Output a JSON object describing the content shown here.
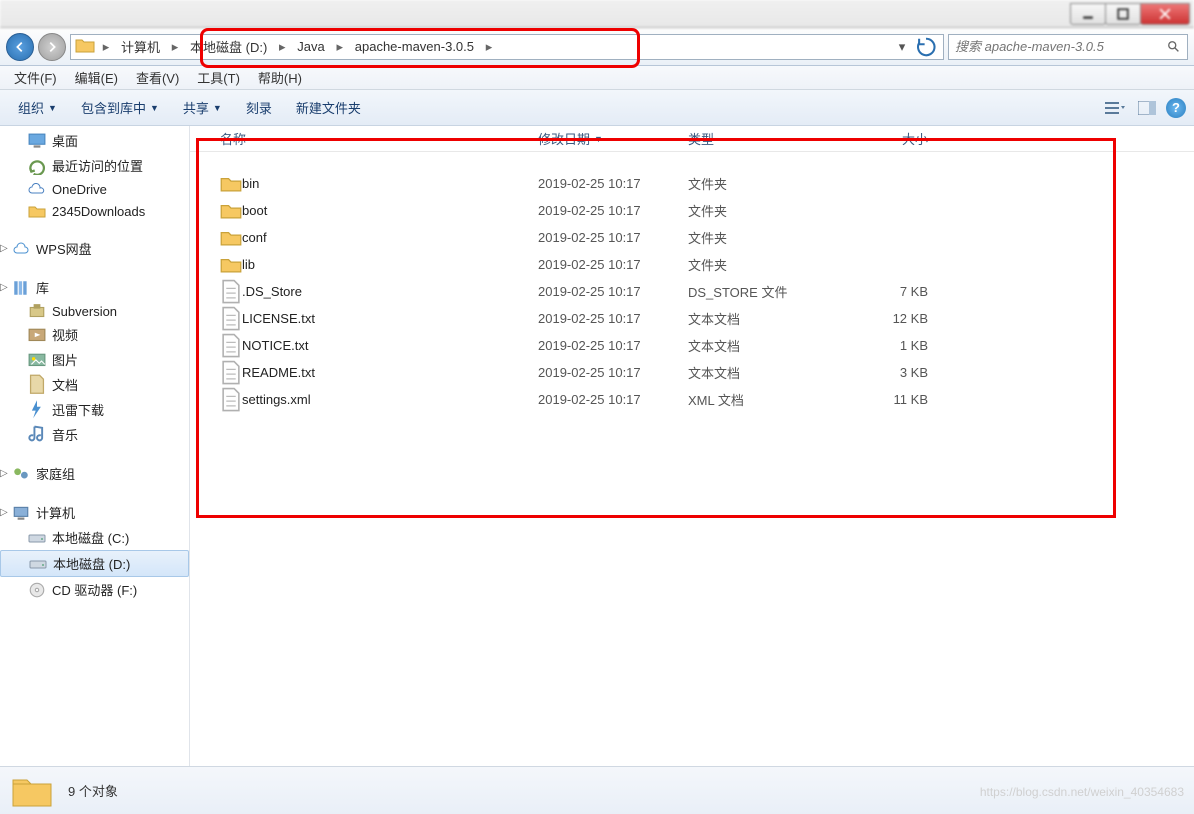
{
  "window": {
    "search_placeholder": "搜索 apache-maven-3.0.5"
  },
  "breadcrumb": [
    "计算机",
    "本地磁盘 (D:)",
    "Java",
    "apache-maven-3.0.5"
  ],
  "menus": {
    "file": "文件(F)",
    "edit": "编辑(E)",
    "view": "查看(V)",
    "tools": "工具(T)",
    "help": "帮助(H)"
  },
  "toolbar": {
    "organize": "组织",
    "include": "包含到库中",
    "share": "共享",
    "burn": "刻录",
    "newfolder": "新建文件夹"
  },
  "sidebar": {
    "favorites": [
      {
        "label": "桌面",
        "icon": "desktop"
      },
      {
        "label": "最近访问的位置",
        "icon": "recent"
      },
      {
        "label": "OneDrive",
        "icon": "onedrive"
      },
      {
        "label": "2345Downloads",
        "icon": "folder"
      }
    ],
    "wps": "WPS网盘",
    "libraries_label": "库",
    "libraries": [
      {
        "label": "Subversion",
        "icon": "svn"
      },
      {
        "label": "视频",
        "icon": "video"
      },
      {
        "label": "图片",
        "icon": "pictures"
      },
      {
        "label": "文档",
        "icon": "documents"
      },
      {
        "label": "迅雷下载",
        "icon": "xunlei"
      },
      {
        "label": "音乐",
        "icon": "music"
      }
    ],
    "homegroup": "家庭组",
    "computer_label": "计算机",
    "drives": [
      {
        "label": "本地磁盘 (C:)",
        "icon": "drive"
      },
      {
        "label": "本地磁盘 (D:)",
        "icon": "drive",
        "selected": true
      },
      {
        "label": "CD 驱动器 (F:)",
        "icon": "cd"
      }
    ]
  },
  "columns": {
    "name": "名称",
    "date": "修改日期",
    "type": "类型",
    "size": "大小"
  },
  "files": [
    {
      "name": "bin",
      "date": "2019-02-25 10:17",
      "type": "文件夹",
      "size": "",
      "icon": "folder"
    },
    {
      "name": "boot",
      "date": "2019-02-25 10:17",
      "type": "文件夹",
      "size": "",
      "icon": "folder"
    },
    {
      "name": "conf",
      "date": "2019-02-25 10:17",
      "type": "文件夹",
      "size": "",
      "icon": "folder"
    },
    {
      "name": "lib",
      "date": "2019-02-25 10:17",
      "type": "文件夹",
      "size": "",
      "icon": "folder"
    },
    {
      "name": ".DS_Store",
      "date": "2019-02-25 10:17",
      "type": "DS_STORE 文件",
      "size": "7 KB",
      "icon": "file"
    },
    {
      "name": "LICENSE.txt",
      "date": "2019-02-25 10:17",
      "type": "文本文档",
      "size": "12 KB",
      "icon": "text"
    },
    {
      "name": "NOTICE.txt",
      "date": "2019-02-25 10:17",
      "type": "文本文档",
      "size": "1 KB",
      "icon": "text"
    },
    {
      "name": "README.txt",
      "date": "2019-02-25 10:17",
      "type": "文本文档",
      "size": "3 KB",
      "icon": "text"
    },
    {
      "name": "settings.xml",
      "date": "2019-02-25 10:17",
      "type": "XML 文档",
      "size": "11 KB",
      "icon": "text"
    }
  ],
  "status": {
    "count_label": "9 个对象"
  },
  "watermark": "https://blog.csdn.net/weixin_40354683"
}
